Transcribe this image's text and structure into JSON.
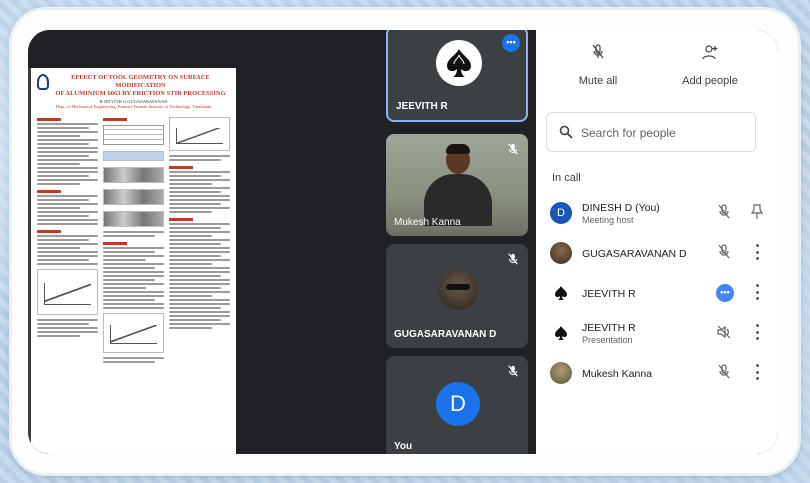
{
  "presentation": {
    "title_line1": "EFFECT OF TOOL GEOMETRY ON SURFACE MODIFICATION",
    "title_line2": "OF ALUMINIUM 6063 BY FRICTION STIR PROCESSING",
    "author": "R.JEEVITH G.GUGASARAVANAN",
    "affiliation": "Dept. of Mechanical Engineering, Bannari Amman Institute of Technology, Tamilnadu"
  },
  "tiles": [
    {
      "name": "JEEVITH R"
    },
    {
      "name": "Mukesh Kanna"
    },
    {
      "name": "GUGASARAVANAN D"
    },
    {
      "name": "You",
      "initial": "D"
    }
  ],
  "panel": {
    "mute_all": "Mute all",
    "add_people": "Add people",
    "search_placeholder": "Search for people",
    "in_call": "In call",
    "participants": [
      {
        "name": "DINESH D (You)",
        "sub": "Meeting host",
        "initial": "D"
      },
      {
        "name": "GUGASARAVANAN D"
      },
      {
        "name": "JEEVITH R"
      },
      {
        "name": "JEEVITH R",
        "sub": "Presentation"
      },
      {
        "name": "Mukesh Kanna"
      }
    ]
  },
  "colors": {
    "accent": "#1a73e8",
    "dark_bg": "#202124",
    "tile_bg": "#3c4043"
  },
  "icons": [
    "mic-off-icon",
    "add-person-icon",
    "search-icon",
    "pin-icon",
    "more-vert-icon",
    "spade-icon",
    "speaker-off-icon"
  ]
}
